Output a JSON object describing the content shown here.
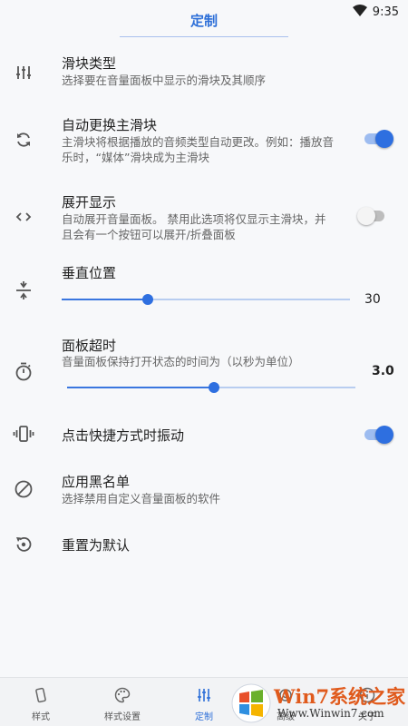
{
  "status_bar": {
    "time": "9:35"
  },
  "header": {
    "title": "定制"
  },
  "settings": [
    {
      "title": "滑块类型",
      "desc": "选择要在音量面板中显示的滑块及其顺序"
    },
    {
      "title": "自动更换主滑块",
      "desc": "主滑块将根据播放的音频类型自动更改。例如：播放音乐时，“媒体”滑块成为主滑块",
      "toggle": true
    },
    {
      "title": "展开显示",
      "desc": "自动展开音量面板。 禁用此选项将仅显示主滑块，并且会有一个按钮可以展开/折叠面板",
      "toggle": false
    },
    {
      "title": "垂直位置",
      "slider_value": "30",
      "slider_fraction": 0.3
    },
    {
      "title": "面板超时",
      "desc": "音量面板保持打开状态的时间为（以秒为单位）",
      "slider_value": "3.0",
      "slider_fraction": 0.51
    },
    {
      "title": "点击快捷方式时振动",
      "toggle": true
    },
    {
      "title": "应用黑名单",
      "desc": "选择禁用自定义音量面板的软件"
    },
    {
      "title": "重置为默认"
    }
  ],
  "bottom_nav": [
    {
      "label": "样式",
      "icon": "phone-style-icon"
    },
    {
      "label": "样式设置",
      "icon": "palette-icon"
    },
    {
      "label": "定制",
      "icon": "sliders-icon",
      "active": true
    },
    {
      "label": "高级",
      "icon": "settings-icon"
    },
    {
      "label": "关于",
      "icon": "info-icon"
    }
  ],
  "watermark": {
    "brand": "Win7系统之家",
    "url": "Www.Winwin7.com"
  },
  "colors": {
    "accent": "#2e6fe0",
    "background": "#f7f8fa"
  }
}
